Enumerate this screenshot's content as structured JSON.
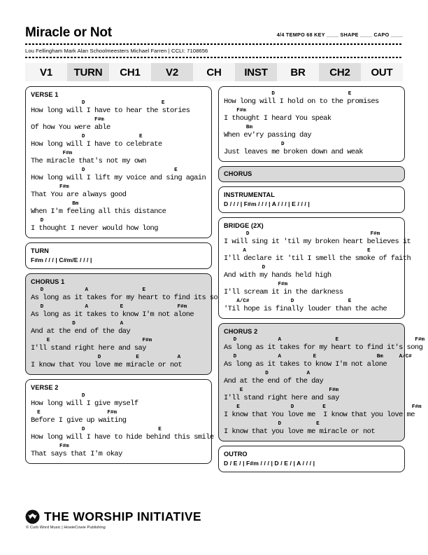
{
  "header": {
    "title": "Miracle or Not",
    "time_signature": "4/4",
    "tempo_label": "TEMPO",
    "tempo_value": "68",
    "key_label": "KEY",
    "key_value": "____",
    "shape_label": "SHAPE",
    "shape_value": "____",
    "capo_label": "CAPO",
    "capo_value": "____",
    "meta_line": "4/4  TEMPO 68  KEY ____  SHAPE ____  CAPO ____",
    "credits": "Lou Fellingham Mark Alan Schoolmeesters Michael Farren | CCLI: 7108656"
  },
  "nav": {
    "items": [
      {
        "label": "V1",
        "shaded": false
      },
      {
        "label": "TURN",
        "shaded": true
      },
      {
        "label": "CH1",
        "shaded": false
      },
      {
        "label": "V2",
        "shaded": true
      },
      {
        "label": "CH",
        "shaded": false
      },
      {
        "label": "INST",
        "shaded": true
      },
      {
        "label": "BR",
        "shaded": false
      },
      {
        "label": "CH2",
        "shaded": true
      },
      {
        "label": "OUT",
        "shaded": false
      }
    ]
  },
  "left_column": {
    "verse1": {
      "label": "VERSE 1",
      "lines": [
        {
          "chords": "                D                        E",
          "lyrics": "How long will I have to hear the stories"
        },
        {
          "chords": "                    F#m",
          "lyrics": "Of how You were able"
        },
        {
          "chords": "                D                 E",
          "lyrics": "How long will I have to celebrate"
        },
        {
          "chords": "          F#m",
          "lyrics": "The miracle that's not my own"
        },
        {
          "chords": "                D                            E",
          "lyrics": "How long will I lift my voice and sing again"
        },
        {
          "chords": "         F#m",
          "lyrics": "That You are always good"
        },
        {
          "chords": "             Bm",
          "lyrics": "When I'm feeling all this distance"
        },
        {
          "chords": "   D",
          "lyrics": "I thought I never would how long"
        }
      ]
    },
    "turn": {
      "label": "TURN",
      "chart": "F#m / / / | C#m/E / / / |"
    },
    "chorus1": {
      "label": "CHORUS 1",
      "lines": [
        {
          "chords": "   D             A                 E                         F#m",
          "lyrics": "As long as it takes for my heart to find its song"
        },
        {
          "chords": "   D             A          E                 F#m",
          "lyrics": "As long as it takes to know I'm not alone"
        },
        {
          "chords": "             D              A",
          "lyrics": "And at the end of the day"
        },
        {
          "chords": "     E                             F#m",
          "lyrics": "I'll stand right here and say"
        },
        {
          "chords": "                     D           E            A",
          "lyrics": "I know that You love me miracle or not"
        }
      ]
    },
    "verse2": {
      "label": "VERSE 2",
      "lines": [
        {
          "chords": "                D",
          "lyrics": "How long will I give myself"
        },
        {
          "chords": "  E                     F#m",
          "lyrics": "Before I give up waiting"
        },
        {
          "chords": "                D                       E",
          "lyrics": "How long will I have to hide behind this smile"
        },
        {
          "chords": "         F#m",
          "lyrics": "That says that I'm okay"
        }
      ]
    }
  },
  "right_column": {
    "verse2_cont": {
      "label": "",
      "lines": [
        {
          "chords": "               D                       E",
          "lyrics": "How long will I hold on to the promises"
        },
        {
          "chords": "    F#m",
          "lyrics": "I thought I heard You speak"
        },
        {
          "chords": "       Bm",
          "lyrics": "When ev'ry passing day"
        },
        {
          "chords": "                  D",
          "lyrics": "Just leaves me broken down and weak"
        }
      ]
    },
    "chorus": {
      "label": "CHORUS"
    },
    "instrumental": {
      "label": "INSTRUMENTAL",
      "chart": "D / / / | F#m / / / | A / / / | E / / / |"
    },
    "bridge": {
      "label": "BRIDGE (2X)",
      "lines": [
        {
          "chords": "       D                                      F#m",
          "lyrics": "I will sing it 'til my broken heart believes it"
        },
        {
          "chords": "      A                                      E",
          "lyrics": "I'll declare it 'til I smell the smoke of faith"
        },
        {
          "chords": "            D",
          "lyrics": "And with my hands held high"
        },
        {
          "chords": "                 F#m",
          "lyrics": "I'll scream it in the darkness"
        },
        {
          "chords": "    A/C#             D                 E",
          "lyrics": "'Til hope is finally louder than the ache"
        }
      ]
    },
    "chorus2": {
      "label": "CHORUS 2",
      "lines": [
        {
          "chords": "   D             A                 E                        F#m",
          "lyrics": "As long as it takes for my heart to find it's song"
        },
        {
          "chords": "   D             A          E                   Bm     A/C#",
          "lyrics": "As long as it takes to know I'm not alone"
        },
        {
          "chords": "             D            A",
          "lyrics": "And at the end of the day"
        },
        {
          "chords": "     E                           F#m",
          "lyrics": "I'll stand right here and say"
        },
        {
          "chords": "    E                D         E                           F#m",
          "lyrics": "I know that You love me  I know that you love me"
        },
        {
          "chords": "                 D           E",
          "lyrics": "I know that you love me miracle or not"
        }
      ]
    },
    "outro": {
      "label": "OUTRO",
      "chart": "D / E / | F#m / / / | D / E / | A / / / |"
    }
  },
  "footer": {
    "brand": "THE WORSHIP INITIATIVE",
    "copyright": "© Curb Word Music | HowieCowie Publishing",
    "logo_icon": "worship-initiative-logo-icon"
  }
}
